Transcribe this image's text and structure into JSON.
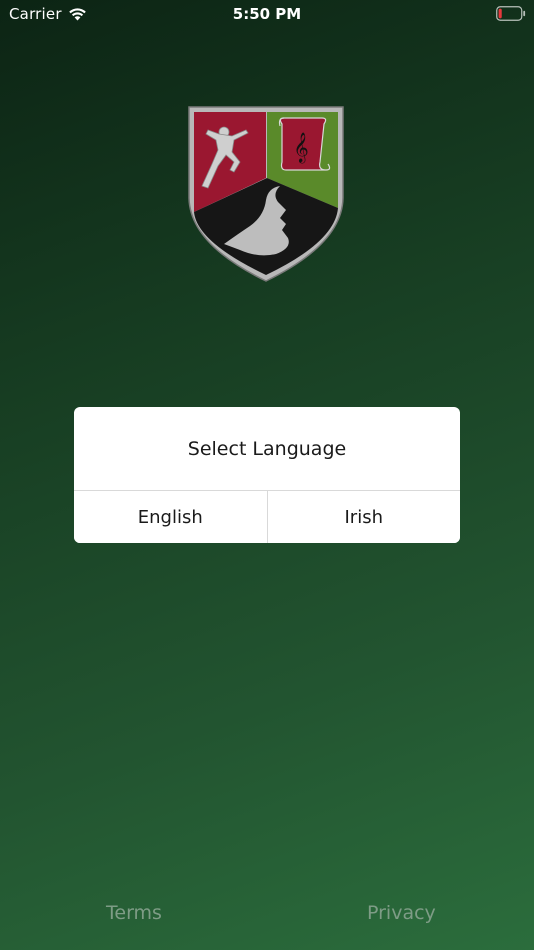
{
  "status_bar": {
    "carrier": "Carrier",
    "time": "5:50 PM",
    "battery_level": 0.1,
    "battery_color": "#e8383d"
  },
  "crest": {
    "icon": "school-crest-icon",
    "colors": {
      "red": "#9a1730",
      "green": "#5a8a2a",
      "black": "#161616",
      "silver": "#b4b4b4"
    }
  },
  "dialog": {
    "title": "Select Language",
    "buttons": [
      "English",
      "Irish"
    ]
  },
  "footer": {
    "terms": "Terms",
    "privacy": "Privacy"
  },
  "colors": {
    "background_top": "#0c2414",
    "background_bottom": "#2b6d3c",
    "footer_text": "#7e9c86"
  }
}
